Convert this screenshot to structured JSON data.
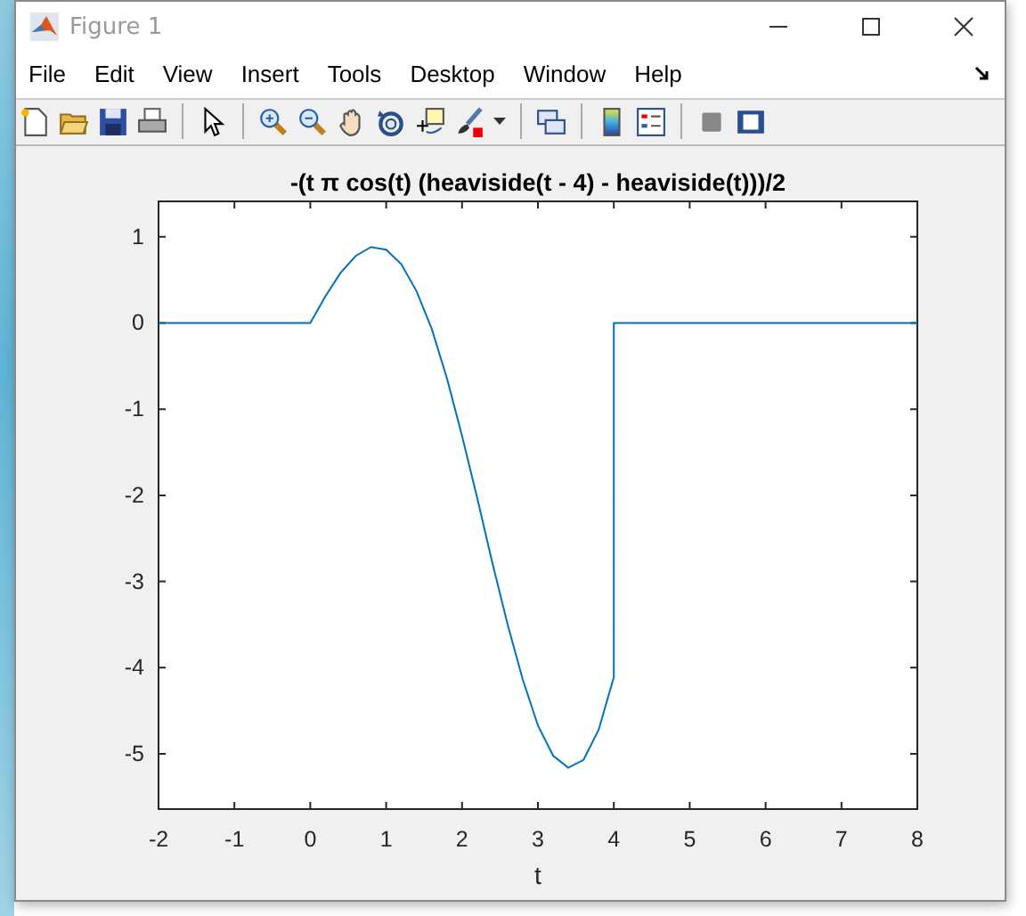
{
  "window": {
    "title": "Figure 1"
  },
  "menu": [
    "File",
    "Edit",
    "View",
    "Insert",
    "Tools",
    "Desktop",
    "Window",
    "Help"
  ],
  "plot": {
    "chart_data": {
      "type": "line",
      "title": "-(t π cos(t) (heaviside(t - 4) - heaviside(t)))/2",
      "xlabel": "t",
      "x": [
        -2,
        0,
        0.2,
        0.4,
        0.6,
        0.8,
        1.0,
        1.2,
        1.4,
        1.6,
        1.8,
        2.0,
        2.2,
        2.4,
        2.6,
        2.8,
        3.0,
        3.2,
        3.4,
        3.6,
        3.8,
        4.0,
        4.0,
        8
      ],
      "series": [
        {
          "color": "#0072bd",
          "values": [
            0,
            0,
            0.31,
            0.58,
            0.78,
            0.88,
            0.85,
            0.68,
            0.37,
            -0.07,
            -0.64,
            -1.31,
            -2.03,
            -2.78,
            -3.5,
            -4.14,
            -4.67,
            -5.02,
            -5.16,
            -5.07,
            -4.72,
            -4.11,
            0,
            0
          ]
        }
      ],
      "xlim": [
        -2,
        8
      ],
      "ylim": [
        -5.64,
        1.41
      ],
      "xticks": [
        -2,
        -1,
        0,
        1,
        2,
        3,
        4,
        5,
        6,
        7,
        8
      ],
      "yticks": [
        -5,
        -4,
        -3,
        -2,
        -1,
        0,
        1
      ]
    }
  }
}
